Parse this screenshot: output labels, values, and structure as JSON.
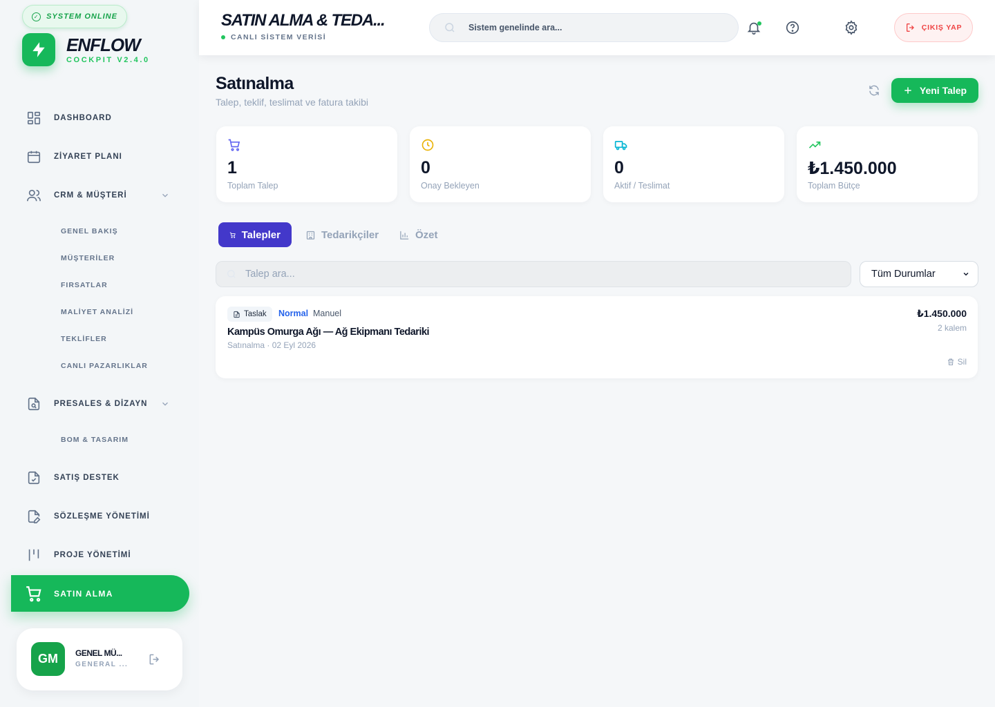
{
  "sidebar": {
    "status_pill": "SYSTEM ONLINE",
    "brand": "ENFLOW",
    "brand_sub": "COCKPIT V2.4.0",
    "nav": {
      "dashboard": "DASHBOARD",
      "visit_plan": "ZİYARET PLANI",
      "crm": "CRM & MÜŞTERİ",
      "crm_sub": [
        "GENEL BAKIŞ",
        "MÜŞTERİLER",
        "FIRSATLAR",
        "MALİYET ANALİZİ",
        "TEKLİFLER",
        "CANLI PAZARLIKLAR"
      ],
      "presales": "PRESALES & DİZAYN",
      "presales_sub": [
        "BOM & TASARIM"
      ],
      "sales_support": "SATIŞ DESTEK",
      "contracts": "SÖZLEŞME YÖNETİMİ",
      "projects": "PROJE YÖNETİMİ",
      "purchasing": "SATIN ALMA"
    },
    "user": {
      "initials": "GM",
      "name": "GENEL MÜ...",
      "role": "GENERAL ..."
    }
  },
  "header": {
    "title": "SATIN ALMA & TEDA...",
    "subtitle": "CANLI SİSTEM VERİSİ",
    "search_placeholder": "Sistem genelinde ara...",
    "logout": "ÇIKIŞ YAP"
  },
  "page": {
    "title": "Satınalma",
    "subtitle": "Talep, teklif, teslimat ve fatura takibi",
    "new_button": "Yeni Talep"
  },
  "stats": [
    {
      "value": "1",
      "label": "Toplam Talep",
      "icon": "cart-icon",
      "color": "#6366f1"
    },
    {
      "value": "0",
      "label": "Onay Bekleyen",
      "icon": "clock-icon",
      "color": "#eab308"
    },
    {
      "value": "0",
      "label": "Aktif / Teslimat",
      "icon": "truck-icon",
      "color": "#06b6d4"
    },
    {
      "value": "₺1.450.000",
      "label": "Toplam Bütçe",
      "icon": "trending-up-icon",
      "color": "#22c55e"
    }
  ],
  "tabs": [
    {
      "label": "Talepler",
      "active": true
    },
    {
      "label": "Tedarikçiler",
      "active": false
    },
    {
      "label": "Özet",
      "active": false
    }
  ],
  "filters": {
    "search_placeholder": "Talep ara...",
    "status_selected": "Tüm Durumlar"
  },
  "requests": [
    {
      "status": "Taslak",
      "priority": "Normal",
      "source": "Manuel",
      "title": "Kampüs Omurga Ağı — Ağ Ekipmanı Tedariki",
      "meta": "Satınalma · 02 Eyl 2026",
      "amount": "₺1.450.000",
      "items": "2 kalem",
      "delete_label": "Sil"
    }
  ],
  "colors": {
    "accent": "#16b85a",
    "tab_active": "#4338ca",
    "priority": "#2563eb",
    "danger": "#ef4444"
  }
}
